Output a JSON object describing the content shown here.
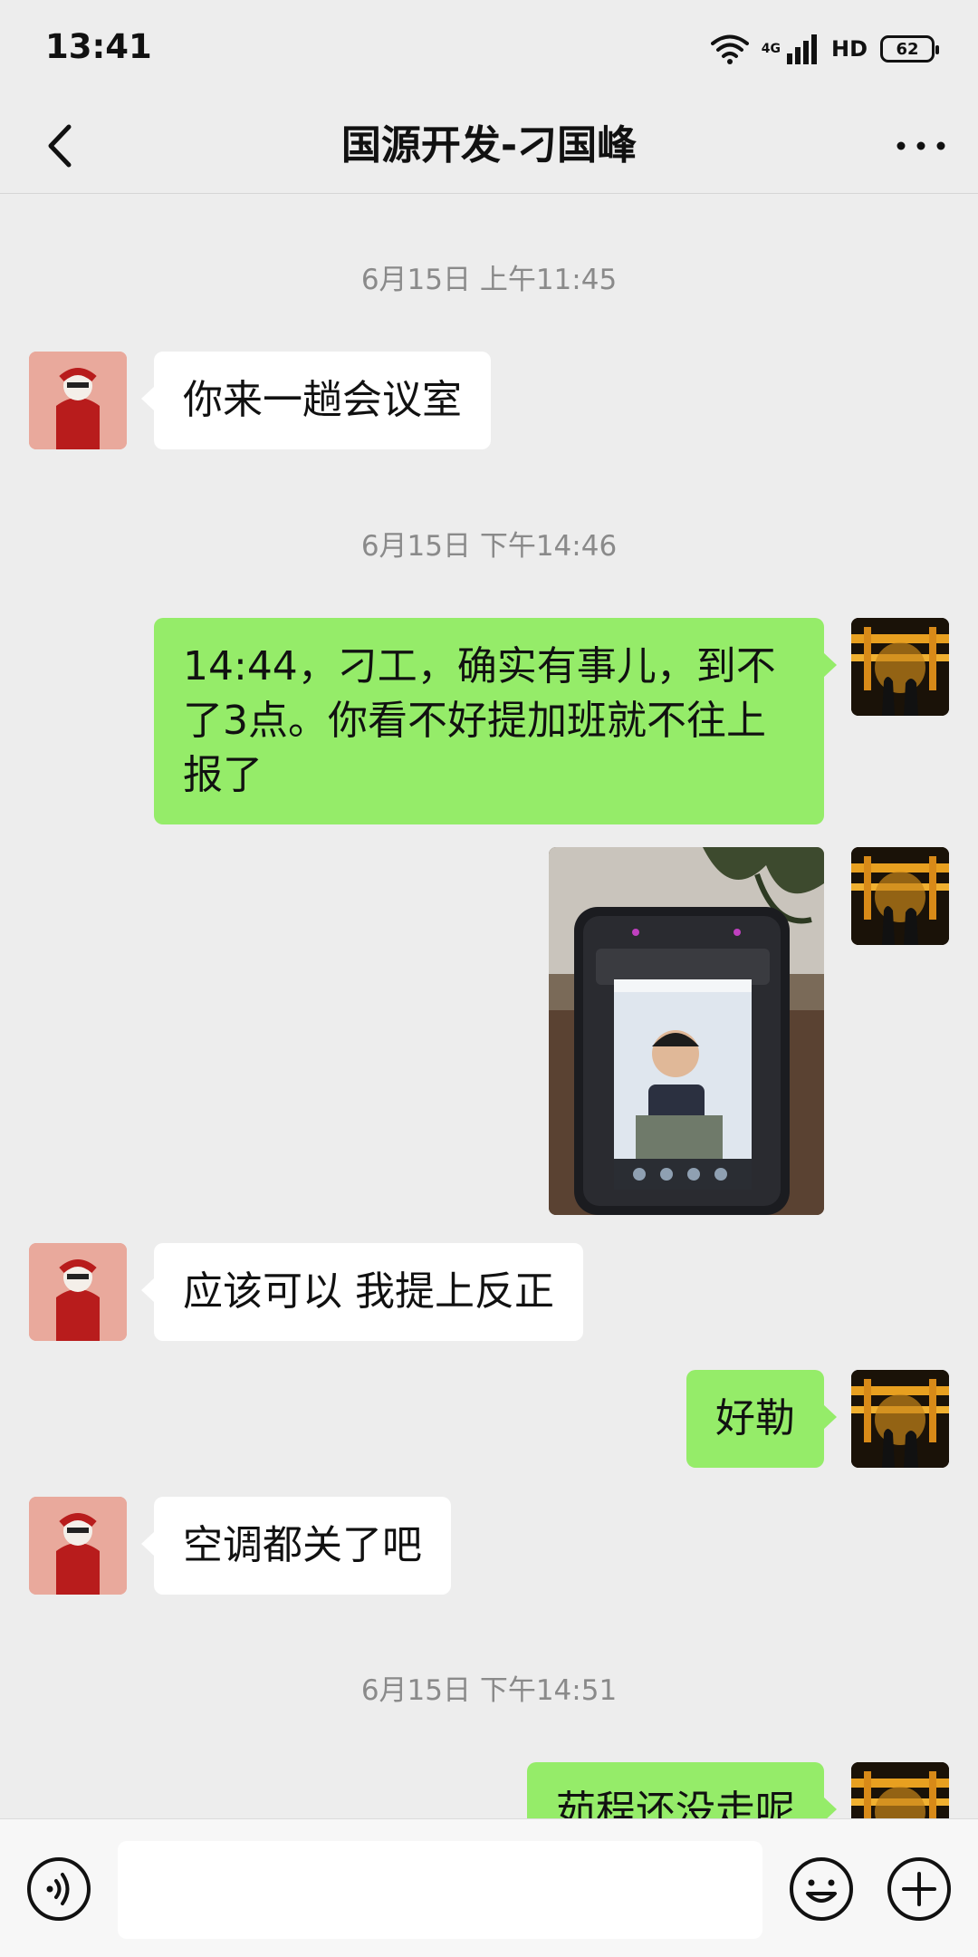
{
  "status": {
    "time": "13:41",
    "network": "4G",
    "hd": "HD",
    "battery": "62",
    "icons": [
      "wifi-icon",
      "signal-icon",
      "hd-icon",
      "battery-icon"
    ]
  },
  "header": {
    "title": "国源开发-刁国峰",
    "back_icon": "chevron-left-icon",
    "more_icon": "more-icon"
  },
  "messages": {
    "ts1": "6月15日 上午11:45",
    "m1": "你来一趟会议室",
    "ts2": "6月15日 下午14:46",
    "m2": "14:44，刁工，确实有事儿，到不了3点。你看不好提加班就不往上报了",
    "m4": "应该可以 我提上反正",
    "m5": "好勒",
    "m6": "空调都关了吧",
    "ts3": "6月15日 下午14:51",
    "m7": "茹程还没走呢"
  },
  "input_bar": {
    "placeholder": "",
    "icons": [
      "voice-icon",
      "emoji-icon",
      "plus-icon"
    ]
  },
  "colors": {
    "background": "#ededed",
    "outgoing_bubble": "#95ec69",
    "incoming_bubble": "#ffffff",
    "timestamp": "#8a8a8a"
  }
}
